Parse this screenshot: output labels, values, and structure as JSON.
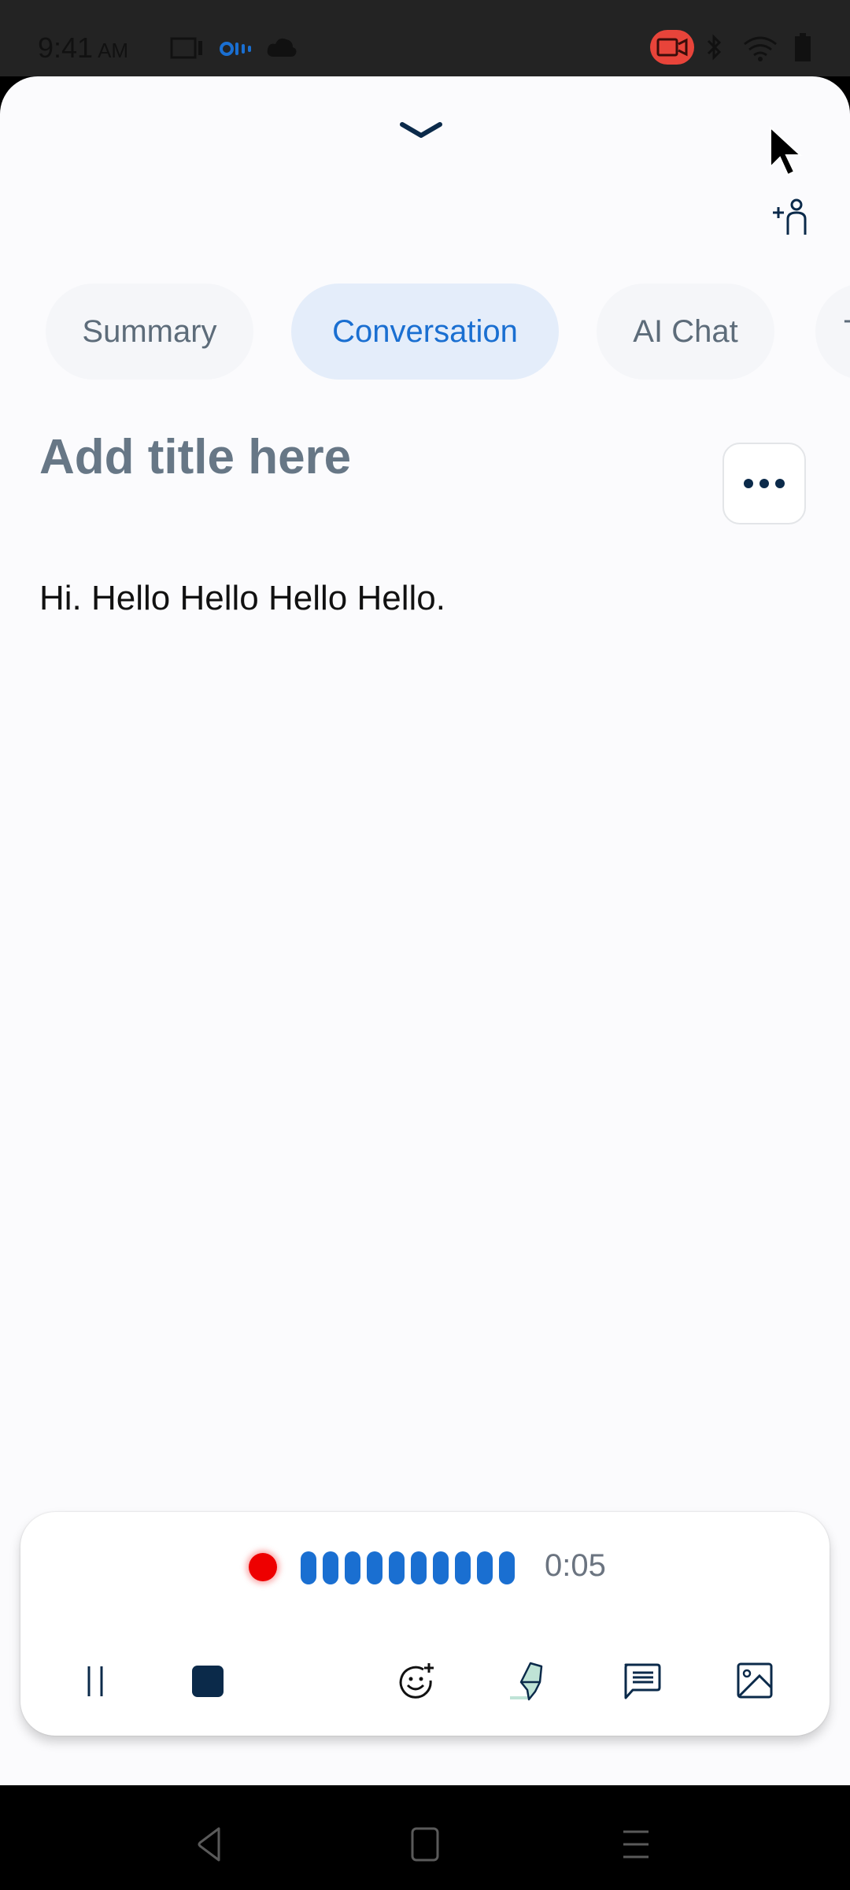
{
  "status_bar": {
    "time": "9:41",
    "ampm": "AM",
    "icons": [
      "screen-icon",
      "otter-app-icon",
      "cloud-upload-icon",
      "screen-record-icon",
      "bluetooth-icon",
      "wifi-icon",
      "battery-icon"
    ],
    "record_indicator_color": "#e8443a"
  },
  "header": {
    "collapse_icon": "chevron-down-icon",
    "share_icon": "add-person-icon"
  },
  "tabs": [
    {
      "label": "Summary",
      "active": false
    },
    {
      "label": "Conversation",
      "active": true
    },
    {
      "label": "AI Chat",
      "active": false
    },
    {
      "label": "T",
      "active": false,
      "partial": true
    }
  ],
  "note": {
    "title_placeholder": "Add title here",
    "more_icon": "more-horizontal-icon",
    "transcript": "Hi. Hello Hello Hello Hello."
  },
  "recorder": {
    "status": "recording",
    "elapsed": "0:05",
    "level_bars": 10,
    "accent_color": "#1a6fd1",
    "record_color": "#ee0000",
    "controls": [
      {
        "name": "pause",
        "icon": "pause-icon"
      },
      {
        "name": "stop",
        "icon": "stop-icon"
      },
      {
        "name": "add-reaction",
        "icon": "emoji-plus-icon"
      },
      {
        "name": "highlight",
        "icon": "highlighter-icon"
      },
      {
        "name": "comment",
        "icon": "comment-icon"
      },
      {
        "name": "add-image",
        "icon": "image-icon"
      }
    ]
  },
  "nav_bar": {
    "buttons": [
      "back",
      "home",
      "recents"
    ]
  }
}
